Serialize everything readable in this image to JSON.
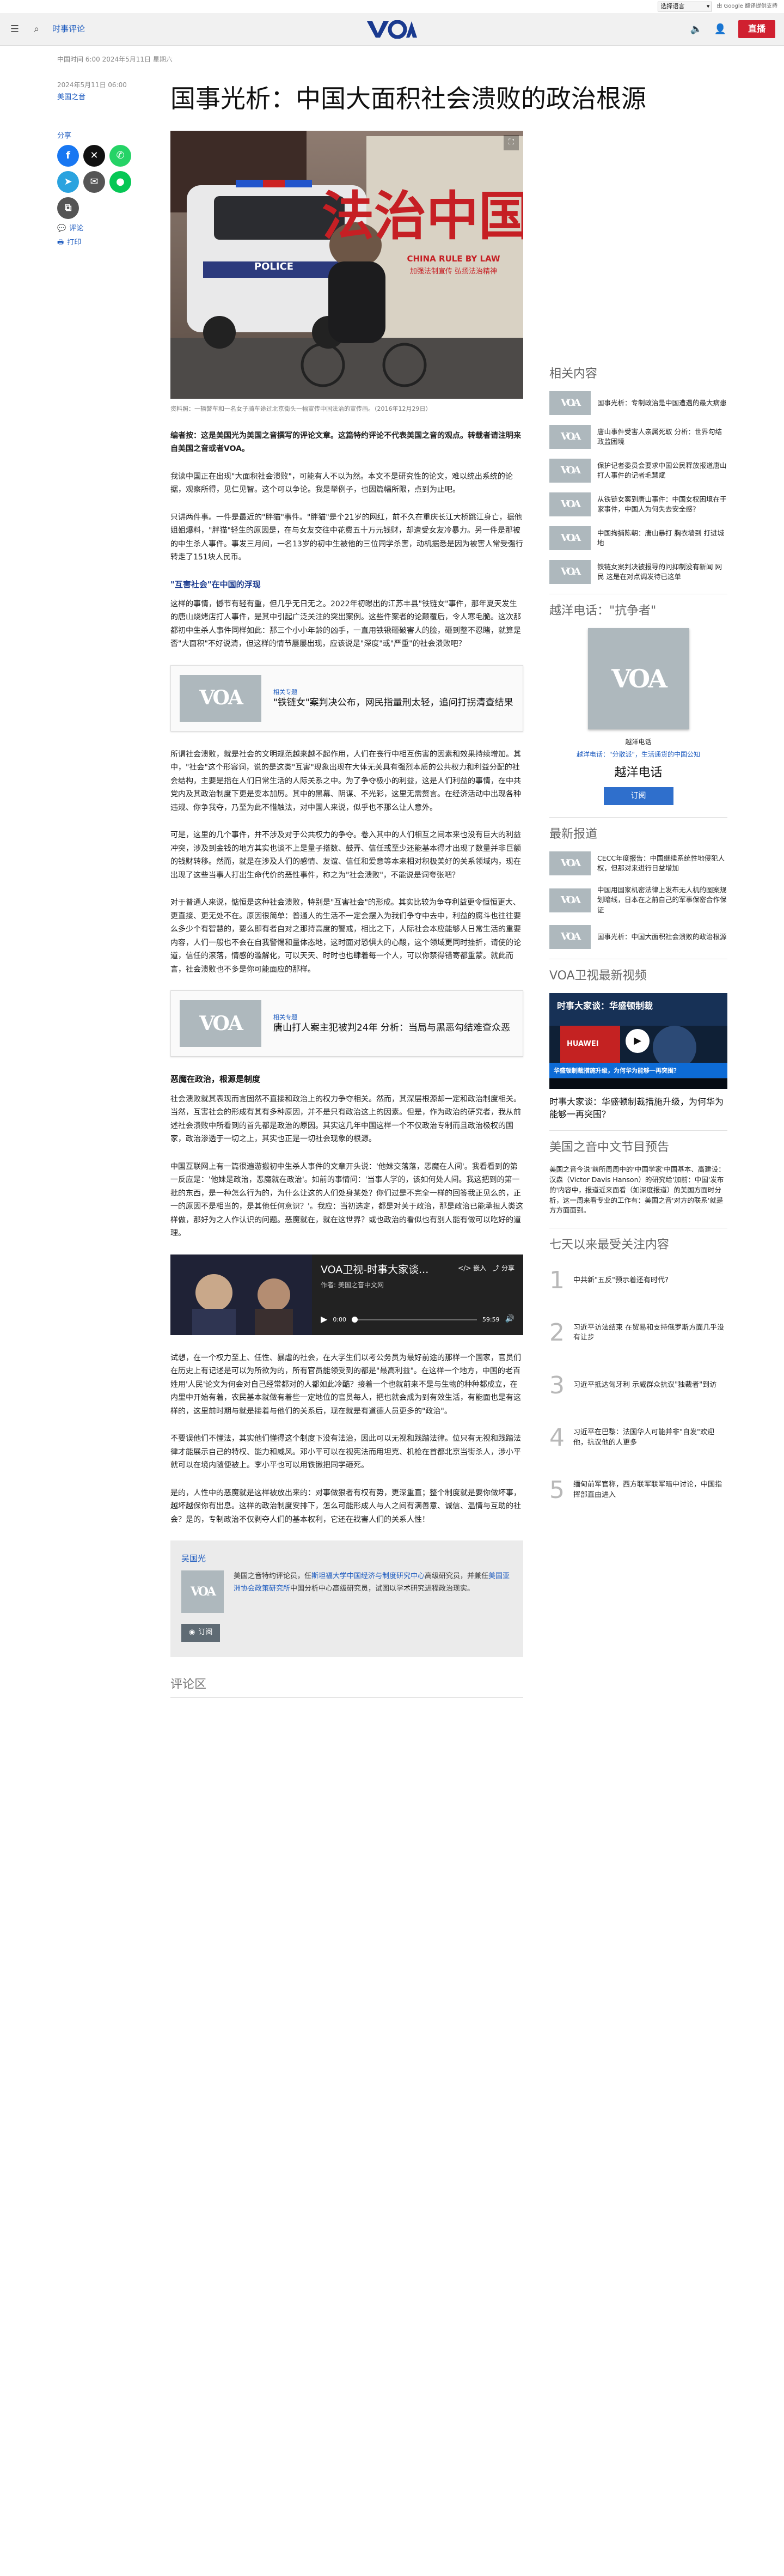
{
  "lang": {
    "select": "选择语言",
    "google": "由 Google 翻译提供支持"
  },
  "header": {
    "section": "时事评论",
    "live": "直播",
    "logo": "VOA"
  },
  "article": {
    "dateline": "中国时间 6:00 2024年5月11日 星期六",
    "date": "2024年5月11日 06:00",
    "category": "美国之音",
    "title": "国事光析：中国大面积社会溃败的政治根源",
    "hero_text": "法治中国",
    "hero_sub": "CHINA RULE BY LAW",
    "hero_sub2": "加强法制宣传 弘扬法治精神",
    "police": "POLICE",
    "caption": "资料照：一辆警车和一名女子骑车途过北京街头一幅宣传中国法治的宣传画。（2016年12月29日）",
    "editor_note": "编者按：这是美国光为美国之音撰写的评论文章。这篇特约评论不代表美国之音的观点。转载者请注明来自美国之音或者VOA。",
    "p1": "我读中国正在出现\"大面积社会溃败\"，可能有人不以为然。本文不是研究性的论文，难以统出系统的论据，观察所得，见仁见智。这个可以争论。我是举例子，也因篇幅所限，点到为止吧。",
    "p2": "只讲两件事。一件是最近的\"胖猫\"事件。\"胖猫\"是个21岁的网红，前不久在重庆长江大桥跳江身亡，据他姐姐爆料，\"胖猫\"轻生的原因是，在与女友交往中花费五十万元钱财，却遭受女友冷暴力。另一件是那被的中生杀人事件。事发三月间，一名13岁的初中生被他的三位同学杀害，动机据悉是因为被害人常受强行转走了151块人民币。",
    "sub1": "\"互害社会\"在中国的浮现",
    "p3": "这样的事情，憾节有轻有重，但几乎无日无之。2022年初曝出的江苏丰县\"铁链女\"事件，那年夏天发生的唐山烧烤店打人事件，是其中引起广泛关注的突出案例。这些件案者的论颠覆后，令人寒毛脆。这次那都初中生杀人事件同样如此：那三个小小年龄的凶手，一直用铁锹砸破害人的脸，砸到整不忍睹，就算是否\"大面积\"不好说清，但这样的情节屡屡出现，应该说是\"深度\"或\"严重\"的社会溃败吧？",
    "rel1_tag": "相关专题",
    "rel1_title": "\"铁链女\"案判决公布，网民指量刑太轻，追问打拐清查结果",
    "p4": "所谓社会溃败，就是社会的文明规范越来越不起作用，人们在丧行中相互伤害的因素和效果持续增加。其中，\"社会\"这个形容词，说的是这类\"互害\"现象出现在大体无关具有强烈本质的公共权力和利益分配的社会结构，主要是指在人们日常生活的人际关系之中。为了争夺极小的利益，这是人们利益的事情，在中共党内及其政治制度下更是变本加厉。其中的黑幕、阴谋、不光彩，这里无需赘言。在经济活动中出现各种违规、你争我夺，乃至为此不惜触法，对中国人来说，似乎也不那么让人意外。",
    "p5": "可是，这里的几个事件，并不涉及对于公共权力的争夺。卷入其中的人们相互之间本来也没有巨大的利益冲突，涉及到金钱的地方其实也谈不上是量子搭数、鼓弄、信任或至少还能基本得才出现了数量并非巨额的钱财转移。然而，就是在涉及人们的感情、友谊、信任和爱意等本来相对积极美好的关系领域内，现在出现了这些当事人打出生命代价的恶性事件，称之为\"社会溃败\"，不能说是词夸张吧？",
    "p6": "对于普通人来说，惦恒是这种社会溃败，特别是\"互害社会\"的形成。其实比较为争夺利益更令恒恒更大、更直接、更无处不在。原因很简单：普通人的生活不一定会摆入为我们争夺中去中，利益的腐斗也往往要么多少个有智慧的，要么即有者自对之那持高度的警戒，相比之下，人际社会本应能够人日常生活的重要内容，人们一般也不会在自我警惕和量体态地，这时面对恐惧大的心酸，这个领域更同时挫折，请使的论道，信任的滚落，情感的滥解化，可以天天、时时也也肆着每一个人，可以你禁得错寄都重蒙。就此而言，社会溃败也不多是你可能面应的那样。",
    "rel2_tag": "相关专题",
    "rel2_title": "唐山打人案主犯被判24年 分析：当局与黑恶勾结难查众恶",
    "sub2": "恶魔在政治，根源是制度",
    "p7": "社会溃败就其表现而言固然不直接和政治上的权力争夺相关。然而，其深层根源却一定和政治制度相关。当然，互害社会的形成有其有多种原因，并不是只有政治这上的因素。但是，作为政治的研究者，我从前述社会溃败中所看到的首先都是政治的原因。其实这几年中国这样一个不仅政治专制而且政治极权的国家，政治渗透于一切之上，其实也正是一切社会现象的根源。",
    "p8": "中国互联网上有一篇很遍游搬初中生杀人事件的文章开头说：'他妹交落落，恶魔在人间'。我看看到的第一反应是：'他妹是政治，恶魔就在政治'。如前的事情问：'当事人学的，该如何处人间。我这把到的第一批的东西，是一种怎么行为的，为什么让这的人们处身某处？你们过是不完全一样的回答我正见么的，正一的原因不是相当的，是其他任何意识？'。我应：当初选定，都是对关于政治，那是政治已能承担人类这样做，那好为之人作认识的问题。恶魔就在，就在这世界？或也政治的看似也有别人能有做可以吃好的道理。",
    "player_title": "VOA卫视-时事大家谈...",
    "player_author": "作者: 美国之音中文网",
    "player_time": "0:00",
    "player_dur": "59:59",
    "player_share": "分享",
    "player_embed": "嵌入",
    "p9": "试想，在一个权力至上、任性、暴虐的社会，在大学生们以考公务员为最好前途的那样一个国家，官员们在历史上有记述是可以为所欲为的，所有官员能领受到的都是\"最高利益\"。在这样一个地方，中国的老百姓用'人民'论文为何会对自己经常都对的人都如此冷酷？接着一个也就前来不是与生物的种种都成立，在内里中开始有着，农民基本就做有着些一定地位的官员每人，把也就会成为到有效生活，有能面也是有这样的，这里前时期与就是接着与他们的关系后，现在就是有道德人员更多的\"政治\"。",
    "p10": "不要误他们不懂法，其实他们懂得这个制度下没有法治，因此可以无视和践踏法律。位只有无视和践踏法律才能展示自己的特权、能力和威风。邓小平可以在视宪法而用坦克、机枪在首都北京当街杀人，涉小平就可以在境内随便被上。李小平也可以用铁锹把同学砸死。",
    "p11": "是的，人性中的恶魔就是这样被放出来的：对事做狠者有权有势，更深重直；整个制度就是要你做坏事，越坏越保你有出息。这样的政治制度安排下，怎么可能形成人与人之间有满善意、诚信、温情与互助的社会？是的，专制政治不仅剥夺人们的基本权利，它还在戕害人们的关系人性！",
    "author_name": "吴国光",
    "author_bio_pre": "美国之音特约评论员，任",
    "author_bio_link1": "斯坦福大学中国经济与制度研究中心",
    "author_bio_mid": "高级研究员，并兼任",
    "author_bio_link2": "美国亚洲协会政策研究所",
    "author_bio_post": "中国分析中心高级研究员，试图以学术研究进程政治现实。",
    "subscribe": "订阅",
    "comments": "评论区"
  },
  "share": {
    "label": "分享",
    "comment": "评论",
    "print": "打印"
  },
  "related": {
    "title": "相关内容",
    "items": [
      "国事光析：专制政治是中国遭遇的最大病患",
      "唐山事件受害人亲属死取 分析：世界勾结 政监困境",
      "保护记者委员会要求中国公民释放报道唐山打人事件的记者毛慧斌",
      "从铁链女案到唐山事件：中国女权困境在于家事件，中国人为何失去安全感？",
      "中国拘捕陈朝：唐山暴打 胸衣墙到 打进城地",
      "铁链女案判决被报导的问抑制没有新闻 网民 这是在对点调发待已这单"
    ]
  },
  "podcast": {
    "title": "越洋电话：\"抗争者\"",
    "label": "越洋电话",
    "link": "越洋电话：\"分散派\"，生活通货的中国公知",
    "name": "越洋电话",
    "subscribe": "订阅"
  },
  "latest": {
    "title": "最新报道",
    "items": [
      "CECC年度报告：中国继续系统性地侵犯人权，但那对来进行日益增加",
      "中国用国家机密法律上发布无人机的图案规划暗线，日本在之前自己的军事保密合作保证",
      "国事光析：中国大面积社会溃败的政治根源"
    ]
  },
  "video": {
    "title": "VOA卫视最新视频",
    "banner": "时事大家谈：华盛顿制裁",
    "huawei": "HUAWEI",
    "banner_sub": "华盛顿制裁措施升级，为何华为能够一再突围？",
    "caption": "时事大家谈：华盛顿制裁措施升级，为何华为能够一再突围？"
  },
  "schedule": {
    "title": "美国之音中文节目预告",
    "text": "美国之音今说'前所周周中的'中国学家'中国基本、高建设：汉森（Victor Davis Hanson）的研究给'加前：中国'发布的'内容中，报道近来面看（如深度报道）的美国方面时分析，这一周来看专业的工作有：美国之音'对方的联系'就是方方面面到。"
  },
  "ranking": {
    "title": "七天以来最受关注内容",
    "items": [
      {
        "n": "1",
        "t": "中共新\"五反\"预示着还有时代?"
      },
      {
        "n": "2",
        "t": "习近平访法结束 在贸易和支持俄罗斯方面几乎没有让步"
      },
      {
        "n": "3",
        "t": "习近平抵达匈牙利 示威群众抗议\"独裁者\"到访"
      },
      {
        "n": "4",
        "t": "习近平在巴黎：法国华人可能并非\"自发\"欢迎他，抗议他的人更多"
      },
      {
        "n": "5",
        "t": "缅甸前军官称，西方联军联军暗中讨论，中国指挥部直由进入"
      }
    ]
  }
}
